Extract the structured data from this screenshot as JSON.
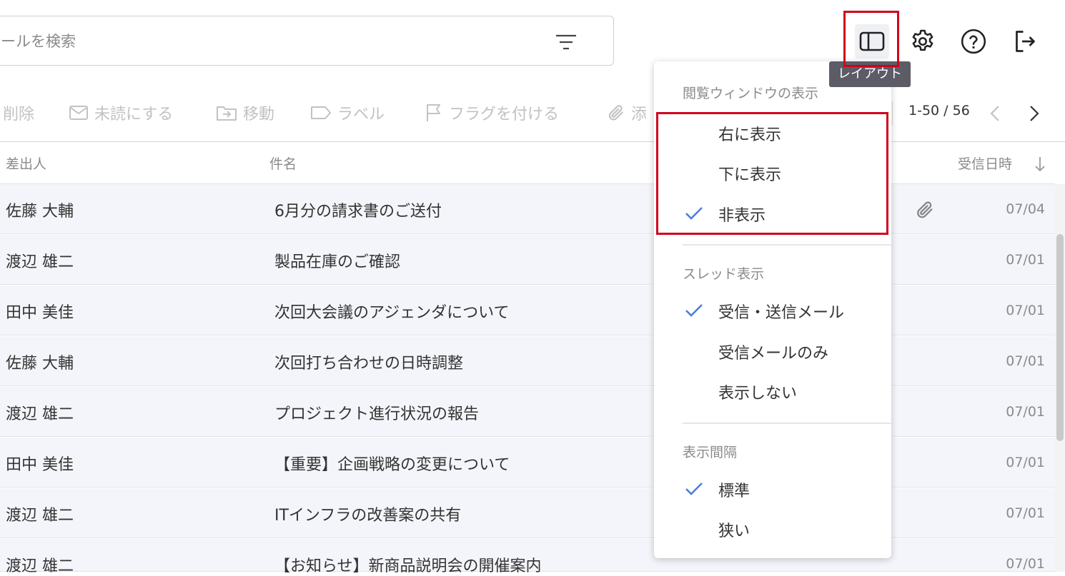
{
  "search": {
    "placeholder": "ールを検索"
  },
  "tooltip": {
    "layout": "レイアウト"
  },
  "toolbar": {
    "delete": "削除",
    "mark_unread": "未読にする",
    "move": "移動",
    "label": "ラベル",
    "flag": "フラグを付ける",
    "attach": "添"
  },
  "pager": {
    "range": "1-50 / 56"
  },
  "columns": {
    "sender": "差出人",
    "subject": "件名",
    "received": "受信日時"
  },
  "emails": [
    {
      "sender": "佐藤 大輔",
      "subject": "6月分の請求書のご送付",
      "date": "07/04",
      "attachment": true
    },
    {
      "sender": "渡辺 雄二",
      "subject": "製品在庫のご確認",
      "date": "07/01"
    },
    {
      "sender": "田中 美佳",
      "subject": "次回大会議のアジェンダについて",
      "date": "07/01"
    },
    {
      "sender": "佐藤 大輔",
      "subject": "次回打ち合わせの日時調整",
      "date": "07/01"
    },
    {
      "sender": "渡辺 雄二",
      "subject": "プロジェクト進行状況の報告",
      "date": "07/01"
    },
    {
      "sender": "田中 美佳",
      "subject": "【重要】企画戦略の変更について",
      "date": "07/01"
    },
    {
      "sender": "渡辺 雄二",
      "subject": "ITインフラの改善案の共有",
      "date": "07/01"
    },
    {
      "sender": "渡辺 雄二",
      "subject": "【お知らせ】新商品説明会の開催案内",
      "date": "07/01"
    }
  ],
  "menu": {
    "reading_pane": {
      "heading": "閲覧ウィンドウの表示",
      "items": [
        {
          "label": "右に表示",
          "checked": false
        },
        {
          "label": "下に表示",
          "checked": false
        },
        {
          "label": "非表示",
          "checked": true
        }
      ]
    },
    "thread": {
      "heading": "スレッド表示",
      "items": [
        {
          "label": "受信・送信メール",
          "checked": true
        },
        {
          "label": "受信メールのみ",
          "checked": false
        },
        {
          "label": "表示しない",
          "checked": false
        }
      ]
    },
    "density": {
      "heading": "表示間隔",
      "items": [
        {
          "label": "標準",
          "checked": true
        },
        {
          "label": "狭い",
          "checked": false
        }
      ]
    }
  },
  "colors": {
    "accent": "#4a7fe0",
    "highlight": "#d0021b",
    "row_bg": "#f4f5fa"
  }
}
